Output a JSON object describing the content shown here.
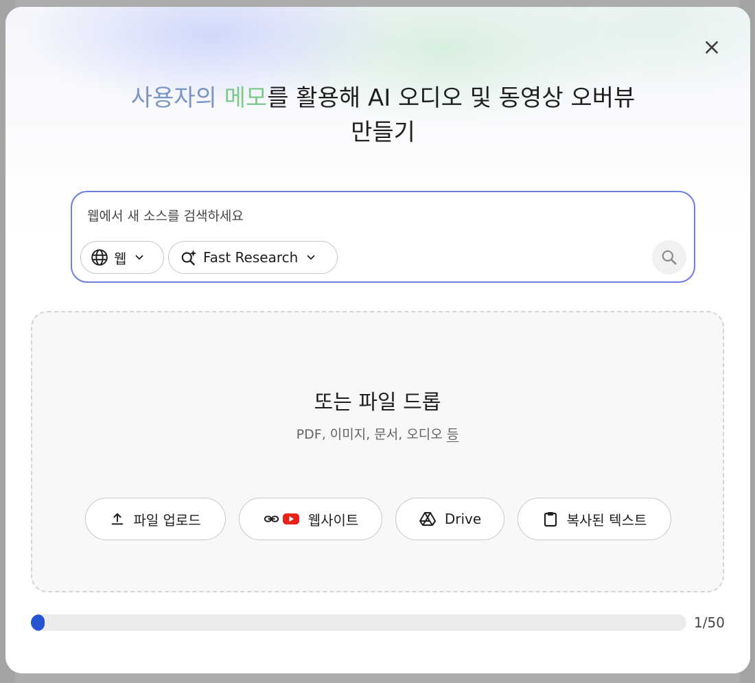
{
  "dialog": {
    "title_part1": "사용자의",
    "title_part2": "메모",
    "title_part3": "를 활용해 AI 오디오 및 동영상 오버뷰",
    "title_line2": "만들기",
    "close_icon": "close-icon",
    "accent_color_1": "#7c94c2",
    "accent_color_2": "#7fc98c"
  },
  "search": {
    "placeholder": "웹에서 새 소스를 검색하세요",
    "source_label": "웹",
    "source_icon": "globe-icon",
    "mode_label": "Fast Research",
    "mode_icon": "sparkle-search-icon",
    "submit_icon": "search-icon",
    "border_color": "#6c7ee1"
  },
  "dropzone": {
    "title": "또는 파일 드롭",
    "subtitle": "PDF, 이미지, 문서, 오디오",
    "subtitle_link": "등",
    "buttons": [
      {
        "label": "파일 업로드",
        "icon": "upload-icon"
      },
      {
        "label": "웹사이트",
        "icon": "link-youtube-icon"
      },
      {
        "label": "Drive",
        "icon": "drive-icon"
      },
      {
        "label": "복사된 텍스트",
        "icon": "clipboard-icon"
      }
    ]
  },
  "sources": {
    "count_text": "1/50",
    "progress_fraction": 0.02,
    "progress_color": "#2455d3"
  }
}
